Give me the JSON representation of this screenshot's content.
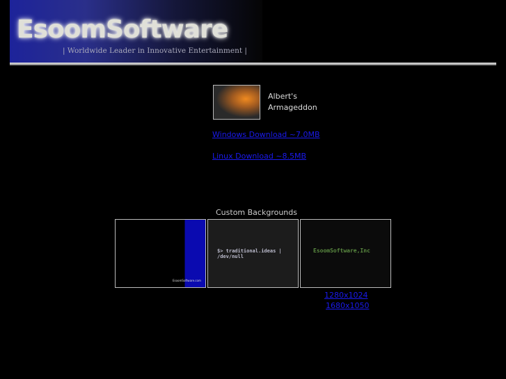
{
  "header": {
    "logo": "EsoomSoftware",
    "tagline": "| Worldwide Leader in Innovative Entertainment |"
  },
  "game": {
    "name_line1": "Albert's",
    "name_line2": "Armageddon",
    "windows_link": "Windows Download ~7.0MB",
    "linux_link": "Linux Download ~8.5MB"
  },
  "backgrounds": {
    "title": "Custom Backgrounds",
    "bg1_text": "EsoomSoftware.com",
    "bg2_text": "$> traditional.ideas | /dev/null",
    "bg3_text": "EsoomSoftware,Inc",
    "res1": "1280x1024",
    "res2": "1680x1050"
  }
}
